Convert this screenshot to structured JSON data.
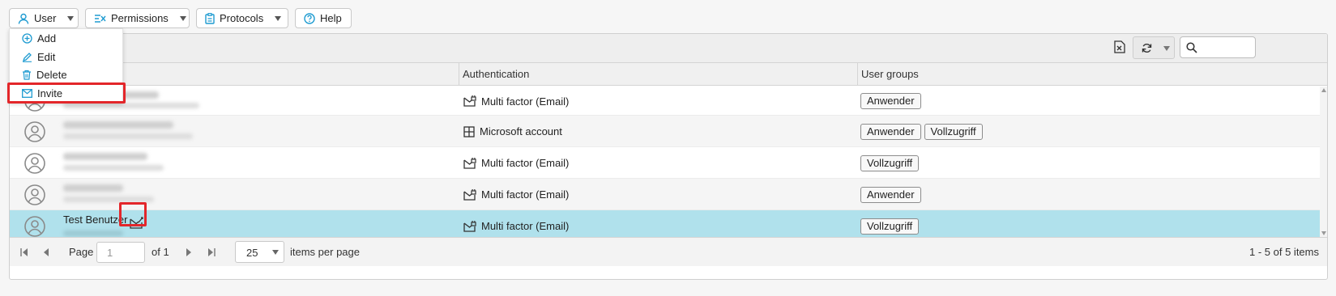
{
  "toolbar": {
    "user_label": "User",
    "permissions_label": "Permissions",
    "protocols_label": "Protocols",
    "help_label": "Help"
  },
  "user_menu": {
    "items": [
      {
        "label": "Add",
        "icon": "plus-circle-icon"
      },
      {
        "label": "Edit",
        "icon": "pencil-icon"
      },
      {
        "label": "Delete",
        "icon": "trash-icon"
      },
      {
        "label": "Invite",
        "icon": "envelope-icon"
      }
    ]
  },
  "grid": {
    "search_placeholder": "",
    "columns": [
      "",
      "Authentication",
      "User groups"
    ],
    "rows": [
      {
        "name": "",
        "authentication": "Multi factor (Email)",
        "auth_icon": "mail-lock-icon",
        "groups": [
          "Anwender"
        ]
      },
      {
        "name": "",
        "authentication": "Microsoft account",
        "auth_icon": "windows-icon",
        "groups": [
          "Anwender",
          "Vollzugriff"
        ]
      },
      {
        "name": "",
        "authentication": "Multi factor (Email)",
        "auth_icon": "mail-lock-icon",
        "groups": [
          "Vollzugriff"
        ]
      },
      {
        "name": "",
        "authentication": "Multi factor (Email)",
        "auth_icon": "mail-lock-icon",
        "groups": [
          "Anwender"
        ]
      },
      {
        "name": "Test Benutzer",
        "authentication": "Multi factor (Email)",
        "auth_icon": "mail-lock-icon",
        "groups": [
          "Vollzugriff"
        ],
        "selected": true
      }
    ]
  },
  "pager": {
    "page_label": "Page",
    "page_value": "1",
    "of_label": "of 1",
    "page_size": "25",
    "items_per_page_label": "items per page",
    "summary": "1 - 5 of 5 items"
  },
  "colors": {
    "accent": "#1e9bd1",
    "selected_row": "#b0e1ec",
    "highlight": "#e3262a"
  }
}
